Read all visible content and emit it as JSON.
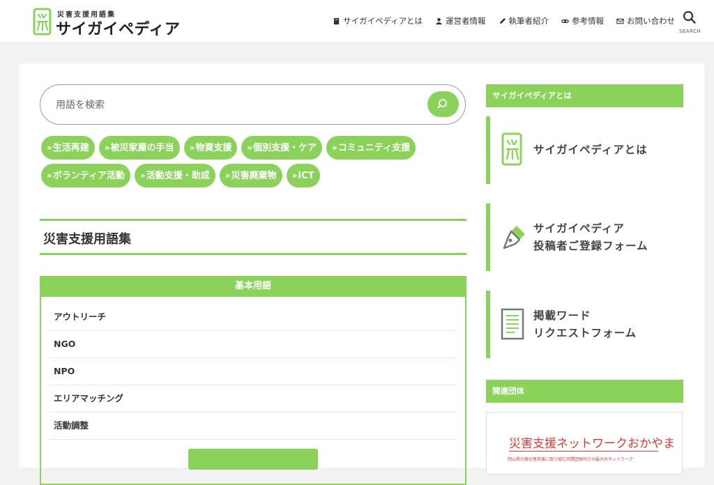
{
  "header": {
    "logo_small": "災害支援用語集",
    "logo_big": "サイガイペディア",
    "nav": [
      {
        "label": "サイガイペディアとは",
        "icon": "book-icon"
      },
      {
        "label": "運営者情報",
        "icon": "user-icon"
      },
      {
        "label": "執筆者紹介",
        "icon": "pencil-icon"
      },
      {
        "label": "参考情報",
        "icon": "link-icon"
      },
      {
        "label": "お問い合わせ",
        "icon": "mail-icon"
      }
    ],
    "search_label": "SEARCH"
  },
  "search": {
    "placeholder": "用語を検索"
  },
  "tags": [
    "生活再建",
    "被災家屋の手当",
    "物資支援",
    "個別支援・ケア",
    "コミュニティ支援",
    "ボランティア活動",
    "活動支援・助成",
    "災害廃棄物",
    "ICT"
  ],
  "tag_prefix": "»",
  "section": {
    "title": "災害支援用語集"
  },
  "term_box": {
    "heading": "基本用語",
    "terms": [
      "アウトリーチ",
      "NGO",
      "NPO",
      "エリアマッチング",
      "活動調整"
    ]
  },
  "sidebar": {
    "about_heading": "サイガイペディアとは",
    "banners": [
      {
        "line1": "サイガイペディアとは",
        "line2": ""
      },
      {
        "line1": "サイガイペディア",
        "line2": "投稿者ご登録フォーム"
      },
      {
        "line1": "掲載ワード",
        "line2": "リクエストフォーム"
      }
    ],
    "related_heading": "関連団体",
    "org": {
      "title": "災害支援ネットワークおかやま",
      "subtitle": "岡山県の被災者支援に取り組む民間団体同士の最大のネットワーク"
    }
  },
  "colors": {
    "accent": "#8bd25a",
    "org_red": "#d83a3a"
  }
}
